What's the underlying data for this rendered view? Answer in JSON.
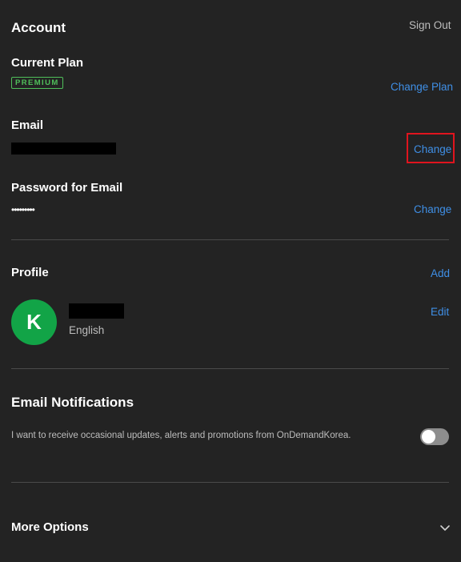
{
  "header": {
    "title": "Account",
    "sign_out": "Sign Out"
  },
  "plan": {
    "label": "Current Plan",
    "badge": "PREMIUM",
    "change_link": "Change Plan"
  },
  "email": {
    "label": "Email",
    "change_link": "Change"
  },
  "password": {
    "label": "Password for Email",
    "value": "•••••••••",
    "change_link": "Change"
  },
  "profile": {
    "title": "Profile",
    "add_link": "Add",
    "avatar_initial": "K",
    "language": "English",
    "edit_link": "Edit"
  },
  "notifications": {
    "title": "Email Notifications",
    "description": "I want to receive occasional updates, alerts and promotions from OnDemandKorea.",
    "enabled": false
  },
  "more_options": {
    "label": "More Options"
  },
  "colors": {
    "background": "#232323",
    "link": "#3f8fe6",
    "premium": "#4fbf5a",
    "avatar": "#12a447",
    "highlight": "#e0141e"
  }
}
